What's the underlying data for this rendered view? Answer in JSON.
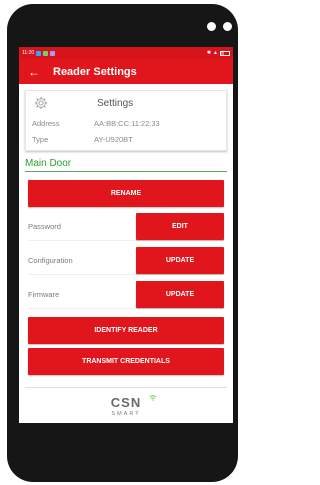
{
  "status_bar": {
    "time": "11:20"
  },
  "header": {
    "back_icon": "←",
    "title": "Reader Settings"
  },
  "settings_card": {
    "title": "Settings",
    "rows": [
      {
        "label": "Address",
        "value": "AA:BB:CC:11:22:33"
      },
      {
        "label": "Type",
        "value": "AY-U920BT"
      }
    ]
  },
  "door_name": "Main Door",
  "buttons": {
    "rename": "RENAME",
    "identify": "IDENTIFY READER",
    "transmit": "TRANSMIT CREDENTIALS"
  },
  "fields": [
    {
      "label": "Password",
      "action": "EDIT"
    },
    {
      "label": "Configuration",
      "action": "UPDATE"
    },
    {
      "label": "Firmware",
      "action": "UPDATE"
    }
  ],
  "logo": {
    "brand": "CSN",
    "sub": "SMART"
  },
  "colors": {
    "accent": "#e1151c",
    "door_name": "#2ca02c"
  }
}
